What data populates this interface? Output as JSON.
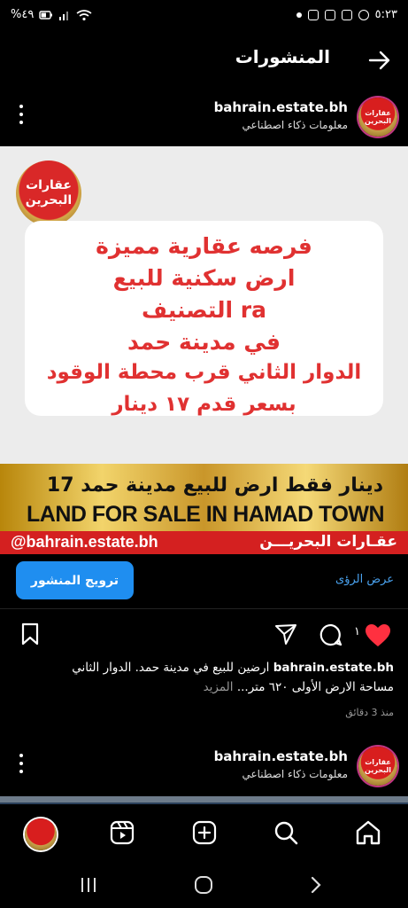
{
  "status_bar": {
    "time": "٥:٢٣",
    "battery": "%٤٩"
  },
  "header": {
    "title": "المنشورات"
  },
  "post": {
    "username": "bahrain.estate.bh",
    "subtitle": "معلومات ذكاء اصطناعي",
    "avatar_text": "عقارات البحرين",
    "image": {
      "logo_line1": "عقارات",
      "logo_line2": "البحرين",
      "lines": [
        "فرصه عقارية مميزة",
        "ارض سكنية للبيع",
        "التصنيف ra",
        "في مدينة حمد",
        "الدوار الثاني قرب محطة الوقود",
        "بسعر قدم ١٧ دينار"
      ],
      "banner_arabic": "17 دينار فقط ارض للبيع مدينة حمد",
      "banner_english": "LAND FOR SALE IN HAMAD TOWN",
      "handle": "@bahrain.estate.bh",
      "brand": "عقـارات البحريـــن"
    },
    "promote_label": "ترويج المنشور",
    "insights_label": "عرض الرؤى",
    "likes": "١",
    "caption_user": "bahrain.estate.bh",
    "caption_line1": "ارضين للبيع في مدينة حمد. الدوار الثاني",
    "caption_line2": "مساحة الارض الأولى ٦٢٠ متر...",
    "more_label": "المزيد",
    "time_ago": "منذ 3 دقائق"
  },
  "next_post": {
    "username": "bahrain.estate.bh",
    "subtitle": "معلومات ذكاء اصطناعي"
  },
  "colors": {
    "accent": "#1f8ef0",
    "like": "#ff3040",
    "link": "#4aa3f0"
  }
}
